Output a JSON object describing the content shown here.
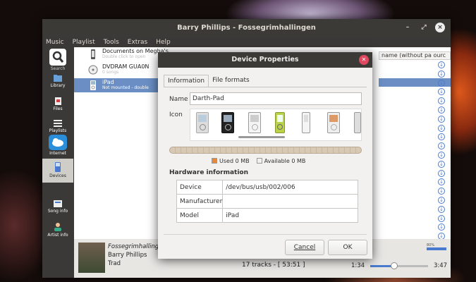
{
  "window": {
    "title": "Barry Phillips - Fossegrimhallingen",
    "controls": [
      "–",
      "⤢",
      "×"
    ]
  },
  "menu": [
    "Music",
    "Playlist",
    "Tools",
    "Extras",
    "Help"
  ],
  "sidebar": {
    "items": [
      {
        "label": "Search",
        "icon": "search-icon"
      },
      {
        "label": "Library",
        "icon": "library-icon"
      },
      {
        "label": "Files",
        "icon": "files-icon"
      },
      {
        "label": "Playlists",
        "icon": "playlists-icon"
      },
      {
        "label": "Internet",
        "icon": "internet-icon"
      },
      {
        "label": "Devices",
        "icon": "devices-icon"
      },
      {
        "label": "Song info",
        "icon": "song-info-icon"
      },
      {
        "label": "Artist info",
        "icon": "artist-info-icon"
      }
    ]
  },
  "devices": [
    {
      "name": "Documents on Megha's",
      "sub": "Double click to open",
      "icon": "phone-icon"
    },
    {
      "name": "DVDRAM GUA0N",
      "sub": "0 songs",
      "icon": "disc-icon"
    },
    {
      "name": "iPad",
      "sub": "Not mounted - double",
      "icon": "ipod-icon"
    }
  ],
  "playlist": {
    "column_header": "name (without pa ourc"
  },
  "now_playing": {
    "title": "Fossegrimhalling",
    "artist": "Barry Phillips",
    "album": "Trad"
  },
  "status": {
    "tracks": "17 tracks - [ 53:51 ]",
    "time_current": "1:34",
    "time_total": "3:47",
    "volume_label": "80%",
    "seek_fraction": 0.42
  },
  "dialog": {
    "title": "Device Properties",
    "tabs": [
      "Information",
      "File formats"
    ],
    "name_label": "Name",
    "name_value": "Darth-Pad",
    "icon_label": "Icon",
    "used_label": "Used 0 MB",
    "available_label": "Available 0 MB",
    "hardware_title": "Hardware information",
    "hardware": [
      {
        "key": "Device",
        "value": "/dev/bus/usb/002/006"
      },
      {
        "key": "Manufacturer",
        "value": ""
      },
      {
        "key": "Model",
        "value": "iPad"
      }
    ],
    "cancel_label": "Cancel",
    "ok_label": "OK"
  },
  "colors": {
    "accent": "#4a7ad0",
    "selection": "#6b8fc4",
    "used": "#e8893a",
    "close": "#e0485f"
  }
}
